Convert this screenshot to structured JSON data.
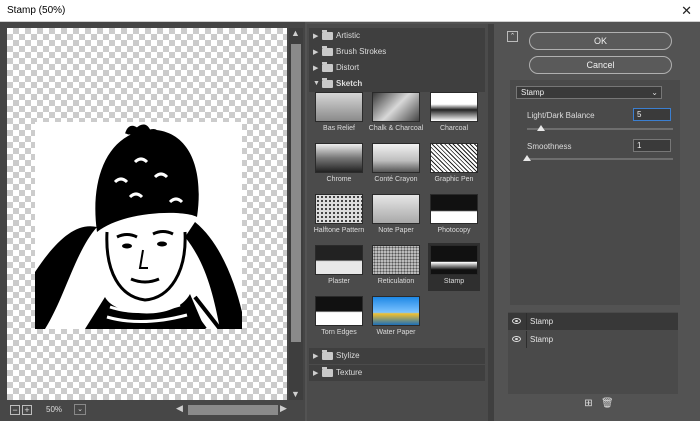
{
  "window": {
    "title": "Stamp (50%)",
    "close_glyph": "✕"
  },
  "preview": {
    "zoom": "50%"
  },
  "gallery": {
    "categories_top": [
      {
        "label": "Artistic",
        "expanded": false
      },
      {
        "label": "Brush Strokes",
        "expanded": false
      },
      {
        "label": "Distort",
        "expanded": false
      },
      {
        "label": "Sketch",
        "expanded": true
      }
    ],
    "filters": [
      {
        "label": "Bas Relief"
      },
      {
        "label": "Chalk & Charcoal"
      },
      {
        "label": "Charcoal"
      },
      {
        "label": "Chrome"
      },
      {
        "label": "Conté Crayon"
      },
      {
        "label": "Graphic Pen"
      },
      {
        "label": "Halftone Pattern"
      },
      {
        "label": "Note Paper"
      },
      {
        "label": "Photocopy"
      },
      {
        "label": "Plaster"
      },
      {
        "label": "Reticulation"
      },
      {
        "label": "Stamp",
        "selected": true
      },
      {
        "label": "Torn Edges"
      },
      {
        "label": "Water Paper"
      }
    ],
    "categories_bottom": [
      {
        "label": "Stylize",
        "expanded": false
      },
      {
        "label": "Texture",
        "expanded": false
      }
    ]
  },
  "buttons": {
    "ok": "OK",
    "cancel": "Cancel"
  },
  "settings": {
    "filter_select": "Stamp",
    "params": [
      {
        "label": "Light/Dark Balance",
        "value": "5",
        "fraction": 0.1
      },
      {
        "label": "Smoothness",
        "value": "1",
        "fraction": 0.0
      }
    ]
  },
  "layers": [
    {
      "name": "Stamp",
      "active": true
    },
    {
      "name": "Stamp",
      "active": false
    }
  ],
  "icons": {
    "collapse": "collapse-icon",
    "folder": "folder-icon",
    "eye": "eye-icon",
    "new_layer": "new-effect-layer-icon",
    "delete": "trash-icon"
  },
  "colors": {
    "accent_focus": "#3b7fd1",
    "panel": "#535353"
  }
}
